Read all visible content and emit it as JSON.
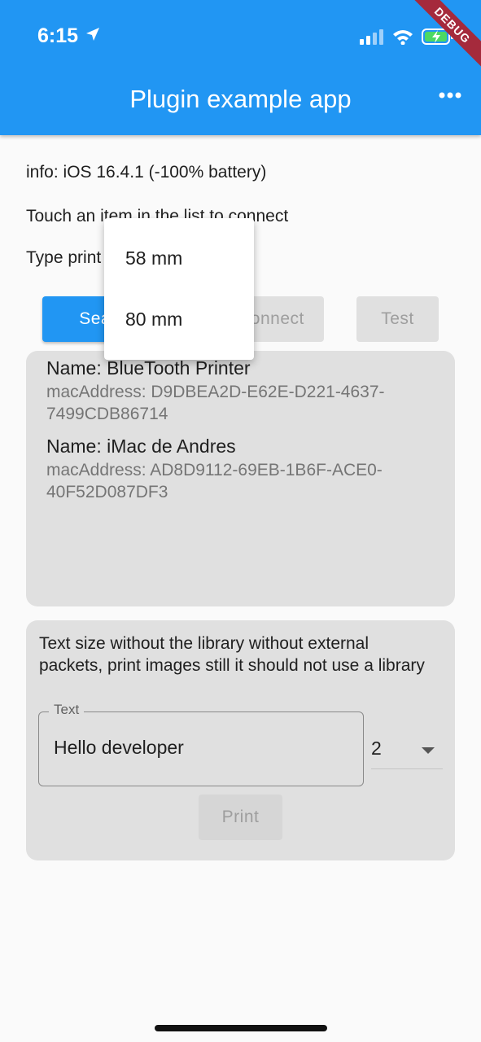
{
  "status_bar": {
    "time": "6:15",
    "debug_badge": "DEBUG"
  },
  "app_bar": {
    "title": "Plugin example app"
  },
  "info": {
    "system_line": "info: iOS 16.4.1 (-100% battery)",
    "instruction": "Touch an item in the list to connect",
    "type_label": "Type print"
  },
  "buttons": {
    "search": "Search",
    "connect": "Connect",
    "test": "Test",
    "print": "Print"
  },
  "paper_size_menu": {
    "options": [
      "58 mm",
      "80 mm"
    ]
  },
  "devices": [
    {
      "name": "Name: BlueTooth Printer",
      "mac": "macAddress: D9DBEA2D-E62E-D221-4637-7499CDB86714"
    },
    {
      "name": "Name: iMac de Andres",
      "mac": "macAddress: AD8D9112-69EB-1B6F-ACE0-40F52D087DF3"
    }
  ],
  "print_panel": {
    "description": "Text size without the library without external packets, print images still it should not use a library",
    "text_field_label": "Text",
    "text_field_value": "Hello developer",
    "size_value": "2"
  },
  "colors": {
    "primary": "#2196f3",
    "card": "#e0e0e0",
    "background": "#fafafa"
  }
}
